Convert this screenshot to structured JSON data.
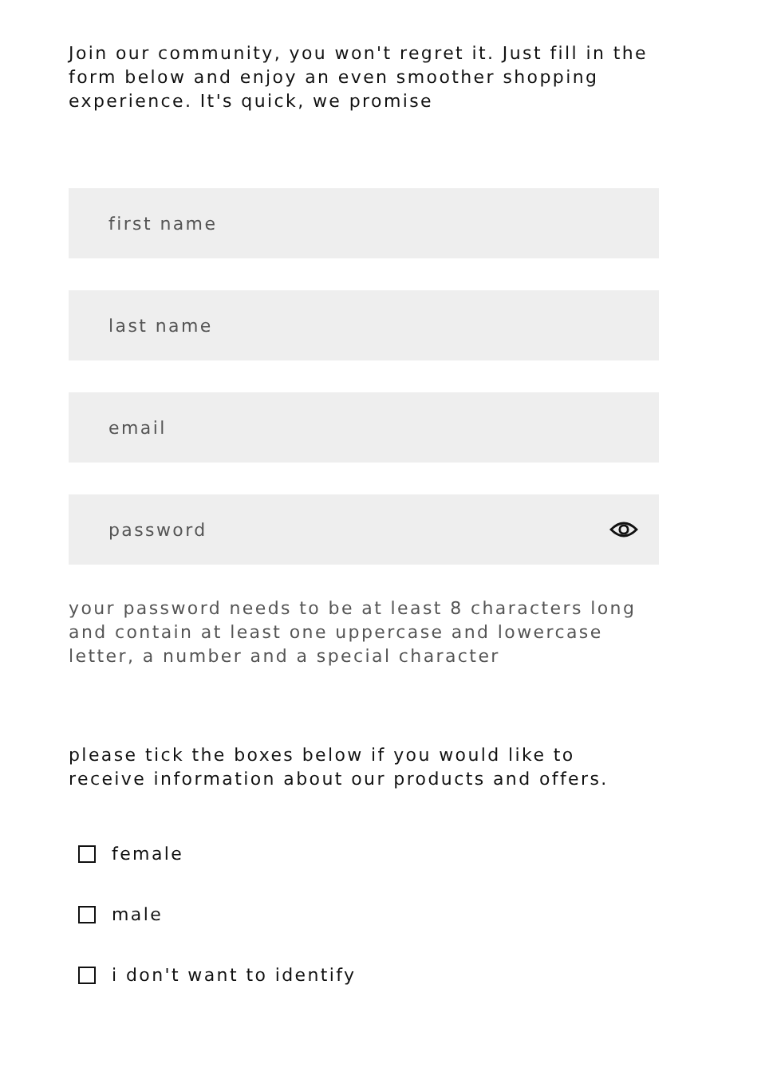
{
  "intro": "Join our community, you won't regret it. Just fill in the form below and enjoy an even smoother shopping experience. It's quick, we promise",
  "fields": [
    {
      "kind": "text",
      "placeholder": "first name"
    },
    {
      "kind": "text",
      "placeholder": "last name"
    },
    {
      "kind": "text",
      "placeholder": "email"
    },
    {
      "kind": "password",
      "placeholder": "password"
    }
  ],
  "password_hint": "your password needs to be at least 8 characters long and contain at least one uppercase and lowercase letter, a number and a special character",
  "consent_text": "please tick the boxes below if you would like to receive information about our products and offers.",
  "options": [
    {
      "label": "female",
      "checked": false
    },
    {
      "label": "male",
      "checked": false
    },
    {
      "label": "i don't want to identify",
      "checked": false
    }
  ]
}
